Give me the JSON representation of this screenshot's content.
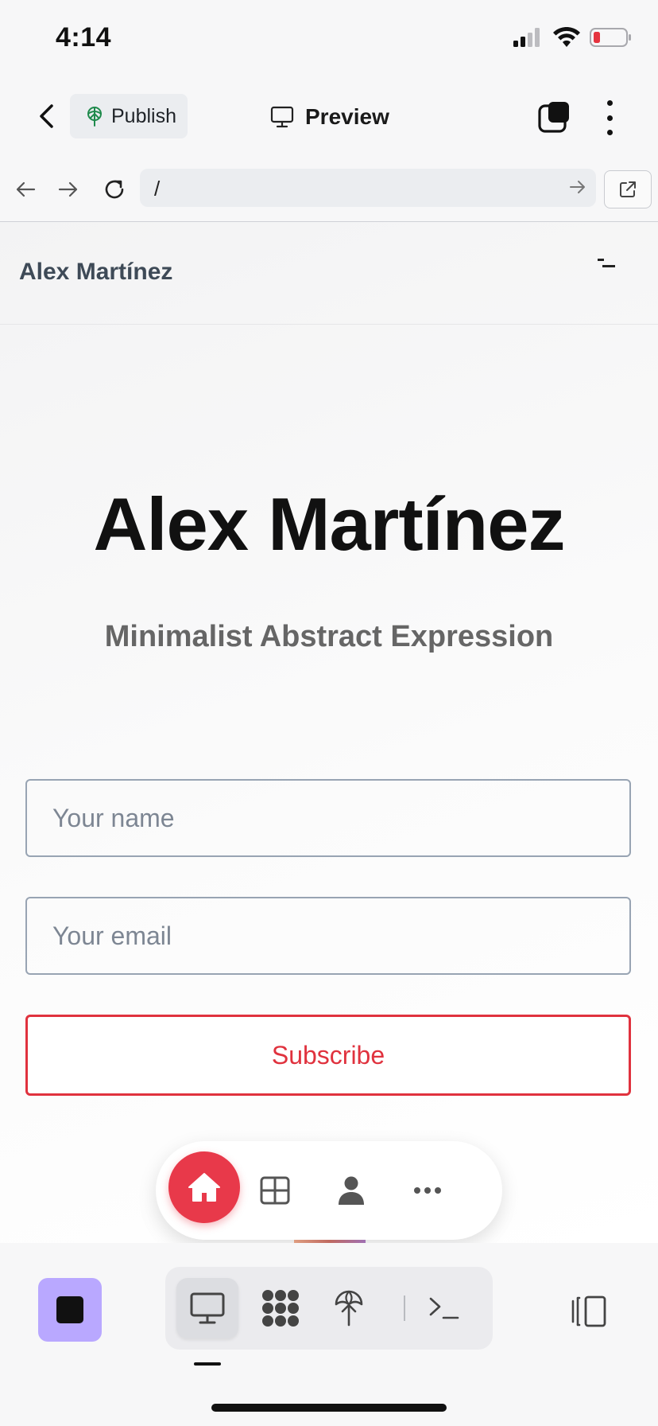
{
  "status_bar": {
    "time": "4:14"
  },
  "app_bar": {
    "publish_label": "Publish",
    "preview_label": "Preview"
  },
  "url_bar": {
    "path": "/"
  },
  "site": {
    "brand": "Alex Martínez",
    "hero_title": "Alex Martínez",
    "hero_subtitle": "Minimalist Abstract Expression",
    "name_placeholder": "Your name",
    "email_placeholder": "Your email",
    "subscribe_label": "Subscribe"
  },
  "floating_nav": {
    "items": [
      "home-icon",
      "grid-icon",
      "user-icon",
      "more-icon"
    ],
    "active": "home-icon"
  },
  "toolbar": {
    "items": [
      "stop-icon",
      "monitor-icon",
      "nodes-icon",
      "deploy-icon",
      "terminal-icon",
      "panel-icon"
    ],
    "active": "monitor-icon"
  },
  "colors": {
    "accent_red": "#e0323e",
    "stop_purple": "#b9a8ff"
  }
}
